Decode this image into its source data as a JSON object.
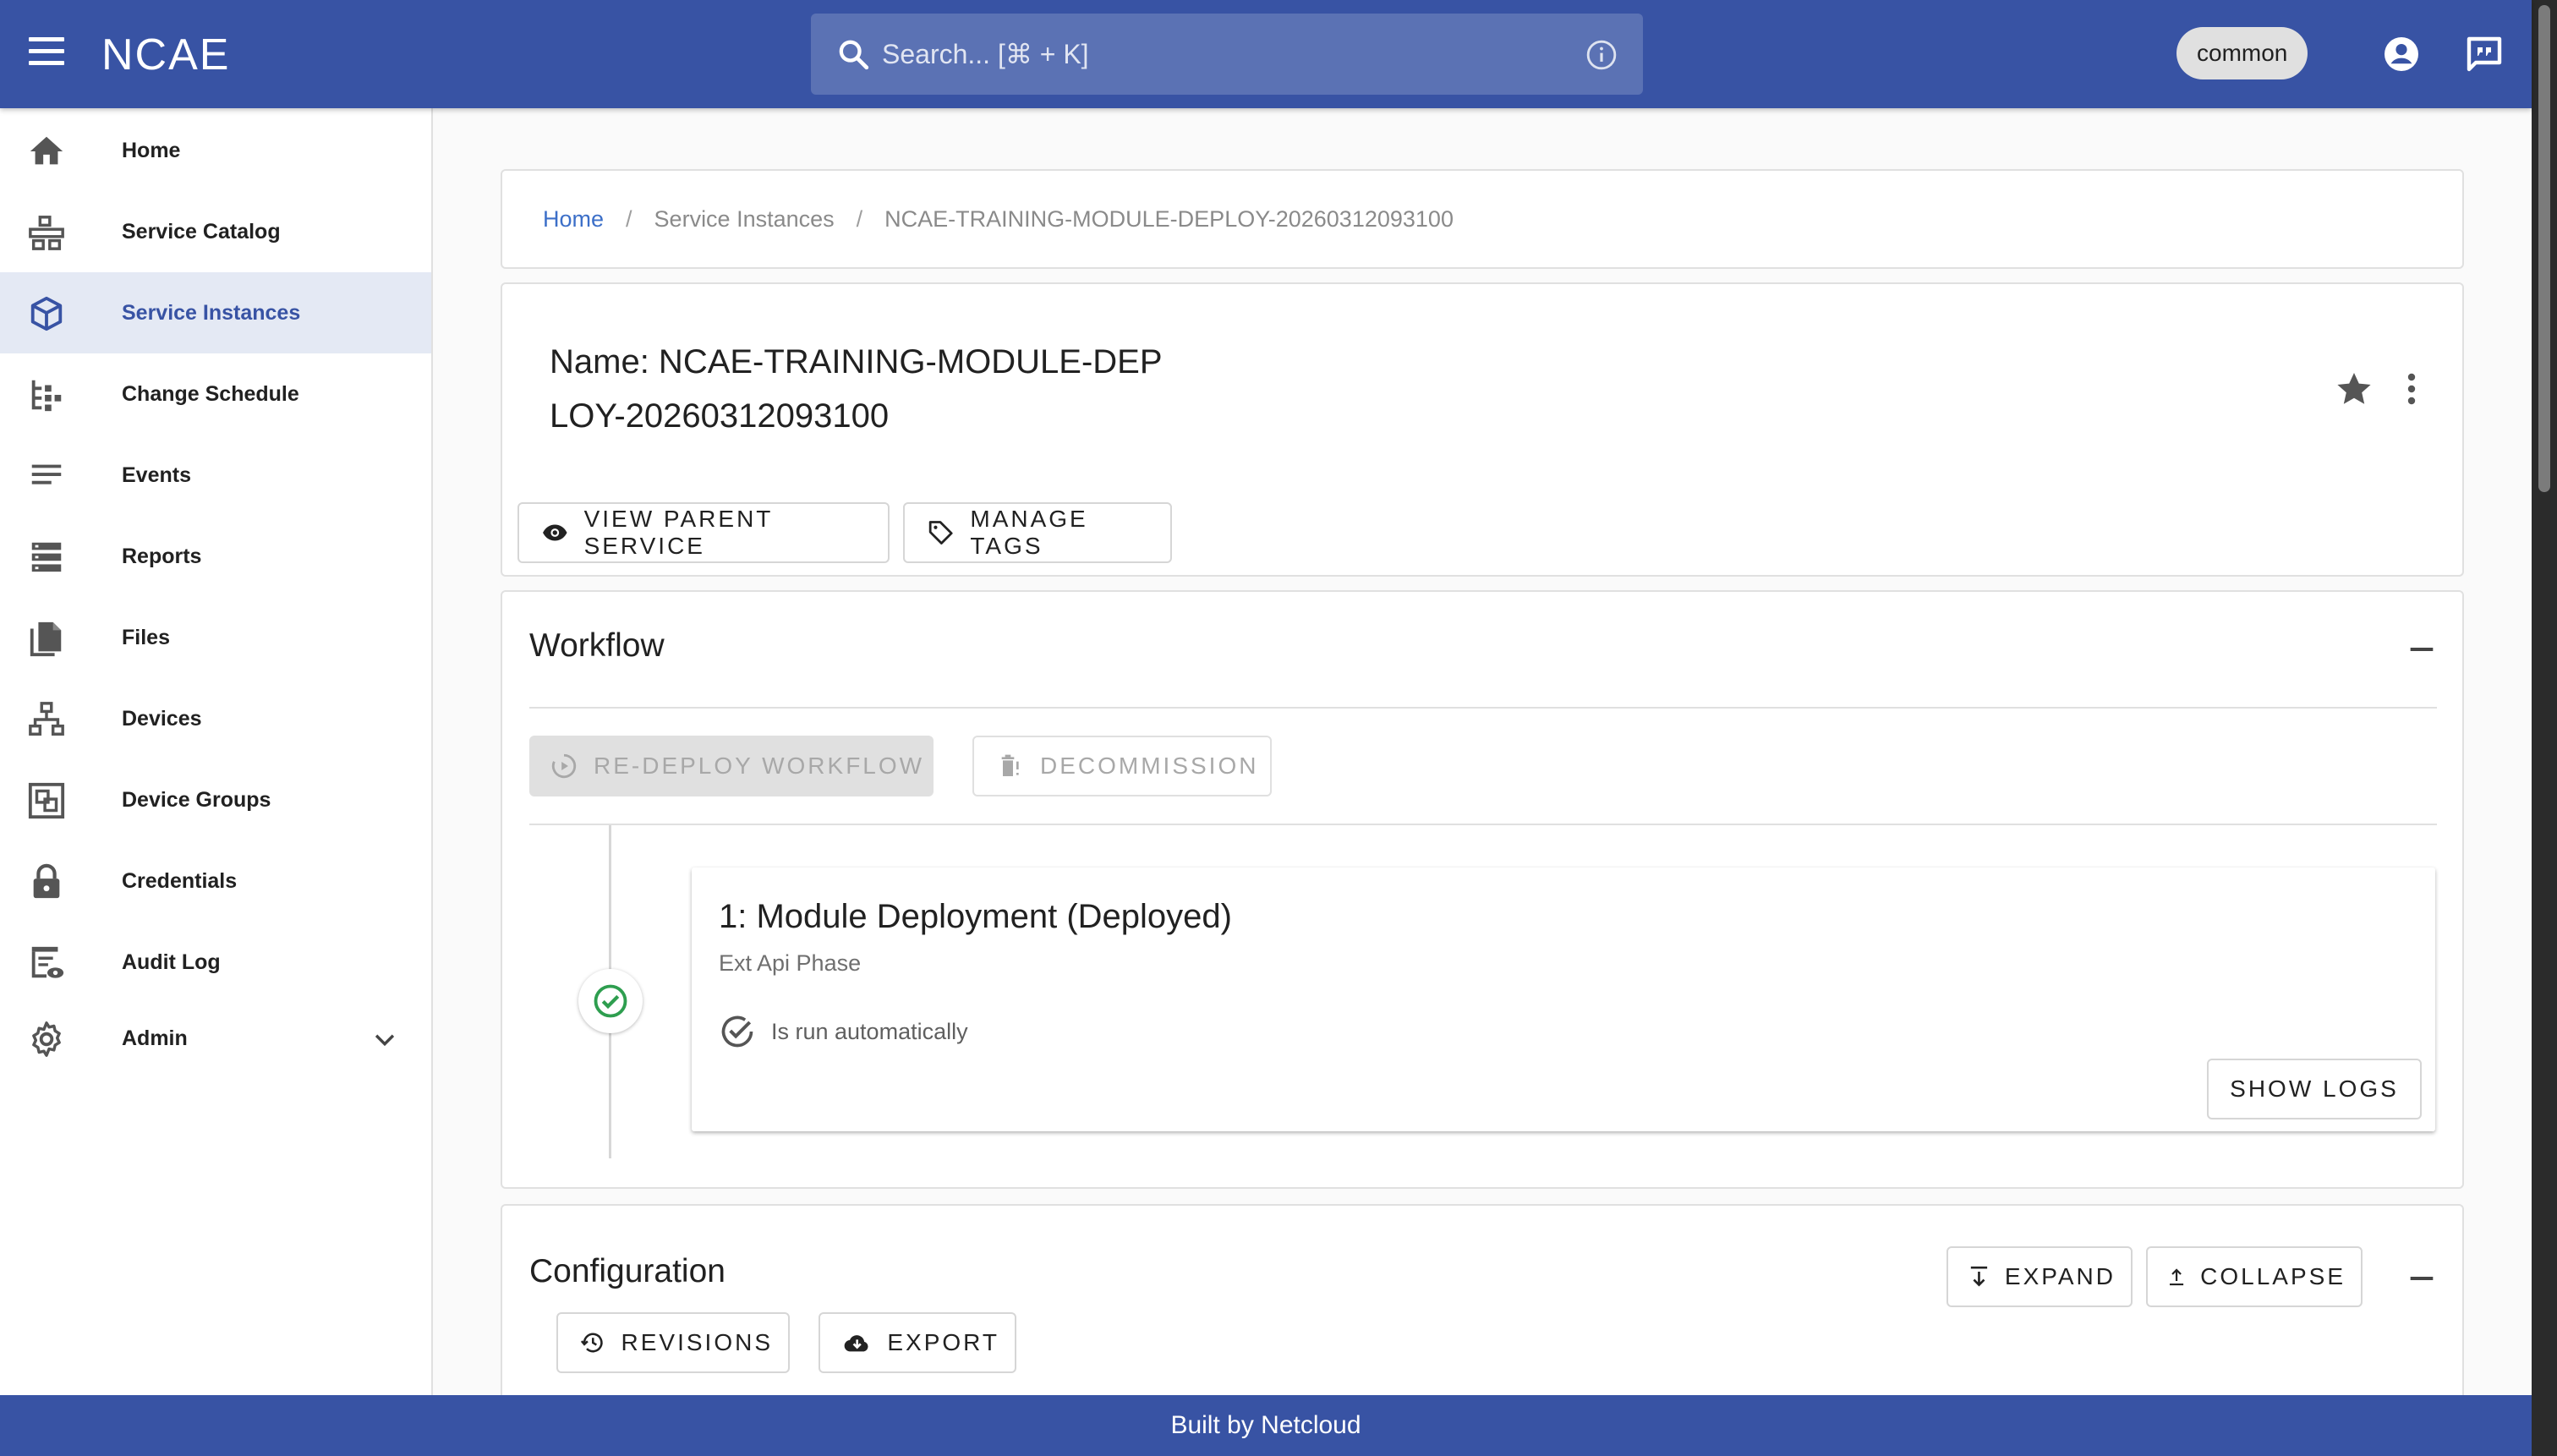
{
  "app": {
    "logo_text": "NCAE",
    "brand_color": "#3853a4",
    "accent_color": "#3c6fc8"
  },
  "search": {
    "placeholder": "Search... [⌘ + K]",
    "icon": "search-icon",
    "info_icon": "info-icon"
  },
  "user_chip": {
    "label": "common"
  },
  "appbar_icons": [
    "account-circle-icon",
    "feedback-icon"
  ],
  "sidebar": {
    "items": [
      {
        "label": "Home",
        "icon": "home-icon"
      },
      {
        "label": "Service Catalog",
        "icon": "service-catalog-icon"
      },
      {
        "label": "Service Instances",
        "icon": "cube-icon",
        "active": true
      },
      {
        "label": "Change Schedule",
        "icon": "change-schedule-icon"
      },
      {
        "label": "Events",
        "icon": "events-icon"
      },
      {
        "label": "Reports",
        "icon": "reports-icon"
      },
      {
        "label": "Files",
        "icon": "files-icon"
      },
      {
        "label": "Devices",
        "icon": "devices-icon"
      },
      {
        "label": "Device Groups",
        "icon": "device-groups-icon"
      },
      {
        "label": "Credentials",
        "icon": "lock-icon"
      },
      {
        "label": "Audit Log",
        "icon": "audit-log-icon"
      },
      {
        "label": "Admin",
        "icon": "gear-icon",
        "expandable": true
      }
    ]
  },
  "breadcrumb": {
    "home": "Home",
    "section": "Service Instances",
    "current": "NCAE-TRAINING-MODULE-DEPLOY-20260312093100",
    "separator": "/"
  },
  "instance": {
    "name_line1": "Name: NCAE-TRAINING-MODULE-DEP",
    "name_line2": "LOY-20260312093100",
    "view_parent_label": "VIEW PARENT SERVICE",
    "manage_tags_label": "MANAGE TAGS"
  },
  "workflow": {
    "title": "Workflow",
    "redeploy_label": "RE-DEPLOY WORKFLOW",
    "decommission_label": "DECOMMISSION",
    "steps": [
      {
        "title": "1: Module Deployment (Deployed)",
        "phase": "Ext Api Phase",
        "auto_text": "Is run automatically",
        "logs_label": "SHOW LOGS",
        "status_color": "#2e9e4f"
      }
    ]
  },
  "configuration": {
    "title": "Configuration",
    "expand_label": "EXPAND",
    "collapse_label": "COLLAPSE",
    "revisions_label": "REVISIONS",
    "export_label": "EXPORT"
  },
  "footer": {
    "text": "Built by Netcloud"
  }
}
